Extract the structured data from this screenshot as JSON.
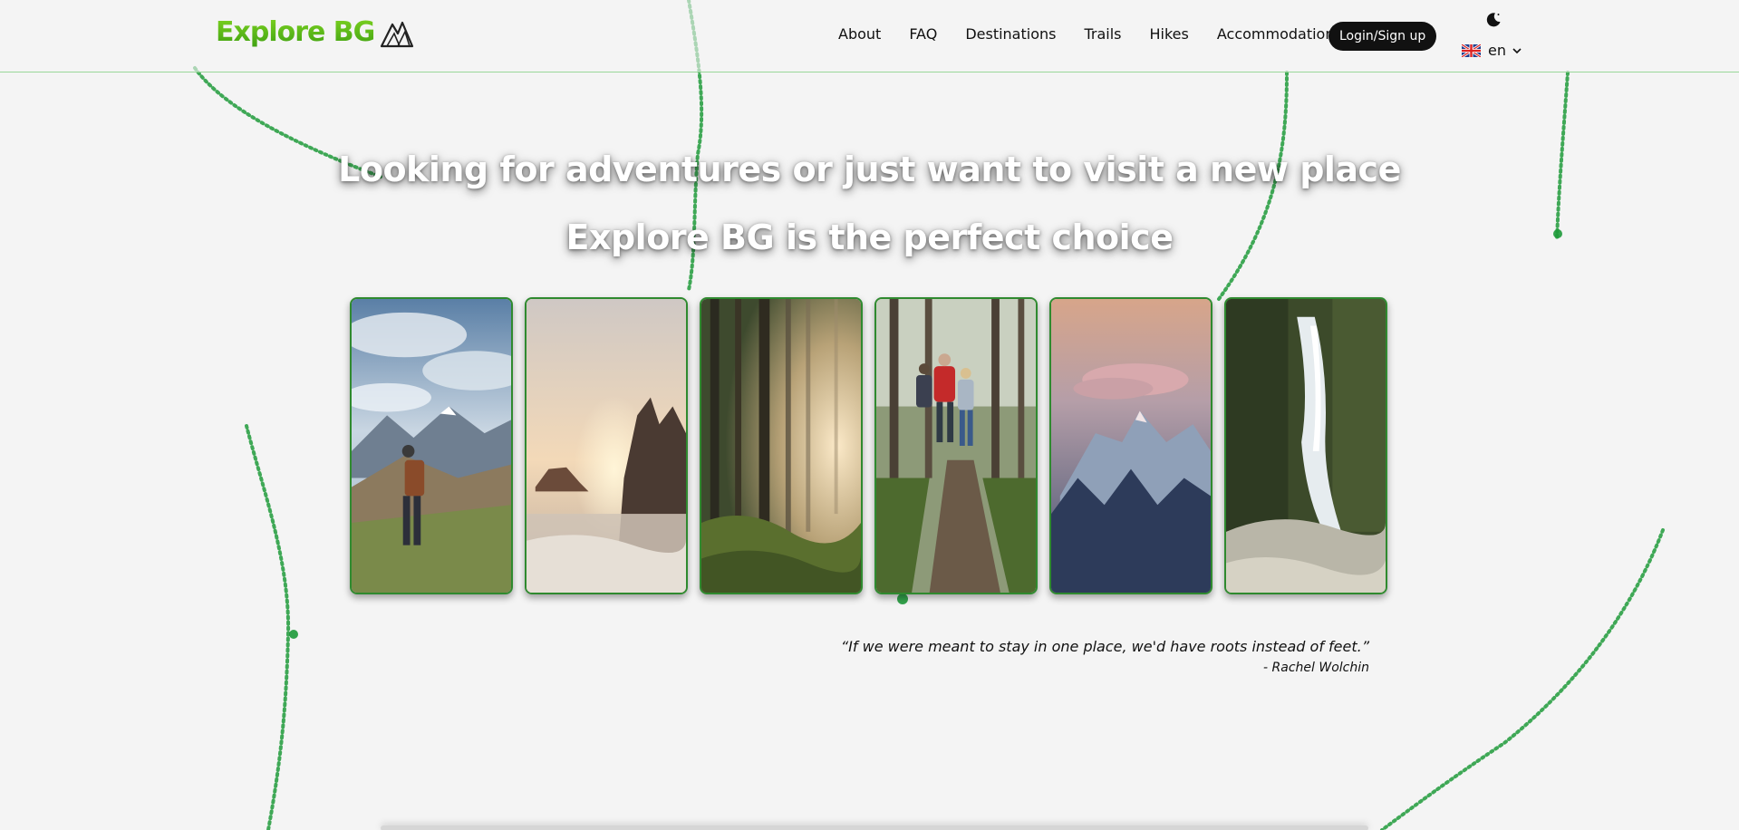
{
  "header": {
    "logo_text": "Explore BG",
    "nav": [
      "About",
      "FAQ",
      "Destinations",
      "Trails",
      "Hikes",
      "Accommodation"
    ],
    "login_label": "Login/Sign up",
    "language": "en",
    "theme_icon": "moon-icon",
    "flag_icon": "uk-flag-icon"
  },
  "hero": {
    "title": "Looking for adventures or just want to visit a new place",
    "subtitle": "Explore BG is the perfect choice"
  },
  "gallery": {
    "images": [
      "hiker-mountains-image",
      "sunset-coast-image",
      "misty-forest-image",
      "hikers-trail-image",
      "pink-mountain-image",
      "waterfall-image"
    ]
  },
  "quote": {
    "text": "“If we were meant to stay in one place, we'd have roots instead of feet.”",
    "author": "- Rachel Wolchin"
  },
  "colors": {
    "accent": "#3ea012",
    "card_border": "#2f8a2f",
    "trail": "#1e9a3a",
    "background": "#f4f4f4"
  }
}
